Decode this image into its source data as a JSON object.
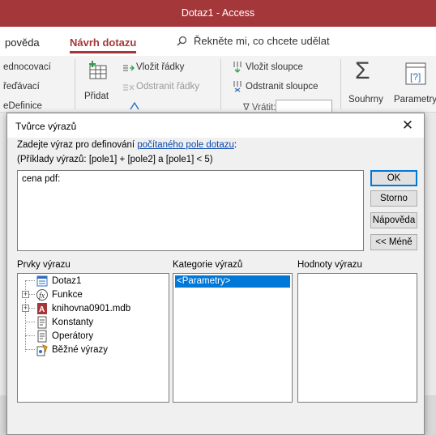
{
  "window": {
    "title": "Dotaz1 - Access"
  },
  "ribbon_tabs": [
    {
      "label": "pověda"
    },
    {
      "label": "Návrh dotazu",
      "active": true
    }
  ],
  "tell_me": {
    "label": "Řekněte mi, co chcete udělat"
  },
  "ribbon": {
    "left_items": [
      "ednocovací",
      "řeďávací"
    ],
    "add_label": "Přidat",
    "insert_rows": "Vložit řádky",
    "delete_rows": "Odstranit řádky",
    "insert_cols": "Vložit sloupce",
    "delete_cols": "Odstranit sloupce",
    "totals": "Souhrny",
    "parameters": "Parametry"
  },
  "dialog": {
    "title": "Tvůrce výrazů",
    "prompt_prefix": "Zadejte výraz pro definování ",
    "prompt_link": "počítaného pole dotazu",
    "prompt_suffix": ":",
    "example": "(Příklady výrazů: [pole1] + [pole2] a [pole1] < 5)",
    "expression_value": "cena pdf:",
    "buttons": {
      "ok": "OK",
      "cancel": "Storno",
      "help": "Nápověda",
      "less": "<< Méně"
    },
    "panels": {
      "elements_label": "Prvky výrazu",
      "categories_label": "Kategorie výrazů",
      "values_label": "Hodnoty výrazu"
    },
    "elements": [
      {
        "label": "Dotaz1",
        "icon": "query-icon"
      },
      {
        "label": "Funkce",
        "icon": "function-icon"
      },
      {
        "label": "knihovna0901.mdb",
        "icon": "database-icon"
      },
      {
        "label": "Konstanty",
        "icon": "constants-icon"
      },
      {
        "label": "Operátory",
        "icon": "operators-icon"
      },
      {
        "label": "Běžné výrazy",
        "icon": "common-expressions-icon"
      }
    ],
    "categories": [
      "<Parametry>"
    ]
  },
  "colors": {
    "access_red": "#a4373a",
    "selection_blue": "#0078d7",
    "link_blue": "#0645ad"
  }
}
